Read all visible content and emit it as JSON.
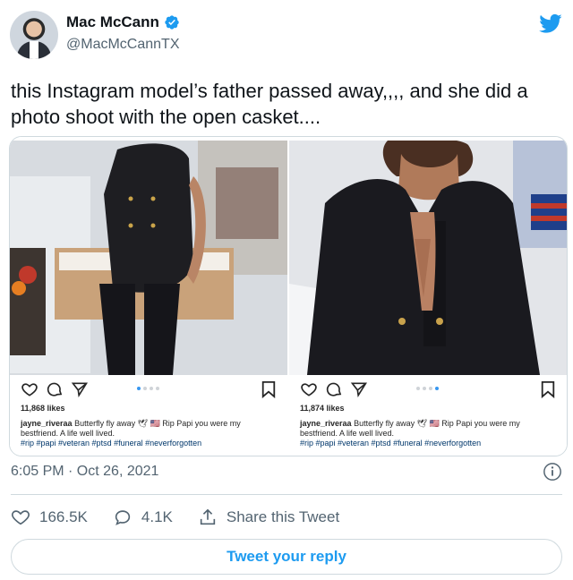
{
  "author": {
    "display_name": "Mac McCann",
    "handle": "@MacMcCannTX"
  },
  "tweet": {
    "text": "this Instagram model’s father passed away,,,, and she did a photo shoot with the open casket...."
  },
  "instagram_posts": [
    {
      "likes": "11,868 likes",
      "username": "jayne_riveraa",
      "caption": "Butterfly fly away 🕊 🇺🇸 Rip Papi you were my bestfriend. A life well lived.",
      "hashtags": "#rip #papi #veteran #ptsd #funeral #neverforgotten",
      "carousel_dots": 4,
      "active_dot": 1
    },
    {
      "likes": "11,874 likes",
      "username": "jayne_riveraa",
      "caption": "Butterfly fly away 🕊 🇺🇸 Rip Papi you were my bestfriend. A life well lived.",
      "hashtags": "#rip #papi #veteran #ptsd #funeral #neverforgotten",
      "carousel_dots": 4,
      "active_dot": 3
    }
  ],
  "meta": {
    "timestamp": "6:05 PM · Oct 26, 2021"
  },
  "stats": {
    "likes": "166.5K",
    "replies": "4.1K",
    "share_label": "Share this Tweet"
  },
  "reply_button_label": "Tweet your reply",
  "colors": {
    "accent": "#1d9bf0",
    "secondary_text": "#536471",
    "border": "#cfd9de"
  }
}
